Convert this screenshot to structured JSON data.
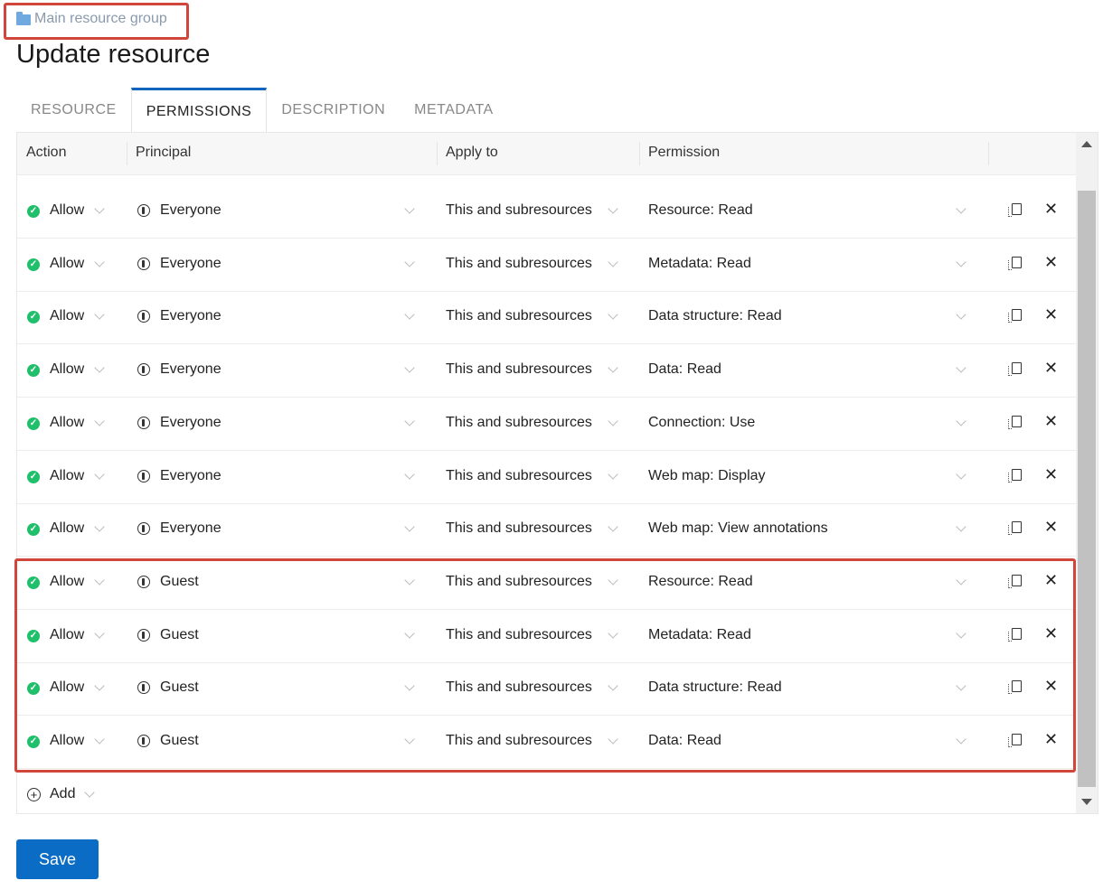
{
  "breadcrumb": {
    "label": "Main resource group",
    "icon": "folder-icon"
  },
  "page_title": "Update resource",
  "tabs": [
    {
      "label": "RESOURCE",
      "active": false
    },
    {
      "label": "PERMISSIONS",
      "active": true
    },
    {
      "label": "DESCRIPTION",
      "active": false
    },
    {
      "label": "METADATA",
      "active": false
    }
  ],
  "table": {
    "headers": [
      "Action",
      "Principal",
      "Apply to",
      "Permission"
    ],
    "rows": [
      {
        "action": "Allow",
        "principal": "Everyone",
        "apply_to": "This and subresources",
        "permission": "Resource: Read"
      },
      {
        "action": "Allow",
        "principal": "Everyone",
        "apply_to": "This and subresources",
        "permission": "Metadata: Read"
      },
      {
        "action": "Allow",
        "principal": "Everyone",
        "apply_to": "This and subresources",
        "permission": "Data structure: Read"
      },
      {
        "action": "Allow",
        "principal": "Everyone",
        "apply_to": "This and subresources",
        "permission": "Data: Read"
      },
      {
        "action": "Allow",
        "principal": "Everyone",
        "apply_to": "This and subresources",
        "permission": "Connection: Use"
      },
      {
        "action": "Allow",
        "principal": "Everyone",
        "apply_to": "This and subresources",
        "permission": "Web map: Display"
      },
      {
        "action": "Allow",
        "principal": "Everyone",
        "apply_to": "This and subresources",
        "permission": "Web map: View annotations"
      },
      {
        "action": "Allow",
        "principal": "Guest",
        "apply_to": "This and subresources",
        "permission": "Resource: Read",
        "highlighted": true
      },
      {
        "action": "Allow",
        "principal": "Guest",
        "apply_to": "This and subresources",
        "permission": "Metadata: Read",
        "highlighted": true
      },
      {
        "action": "Allow",
        "principal": "Guest",
        "apply_to": "This and subresources",
        "permission": "Data structure: Read",
        "highlighted": true
      },
      {
        "action": "Allow",
        "principal": "Guest",
        "apply_to": "This and subresources",
        "permission": "Data: Read",
        "highlighted": true
      }
    ],
    "add_label": "Add"
  },
  "save_label": "Save",
  "colors": {
    "accent": "#0a6cc4",
    "allow": "#1fbf6b",
    "highlight": "#d0463b"
  }
}
